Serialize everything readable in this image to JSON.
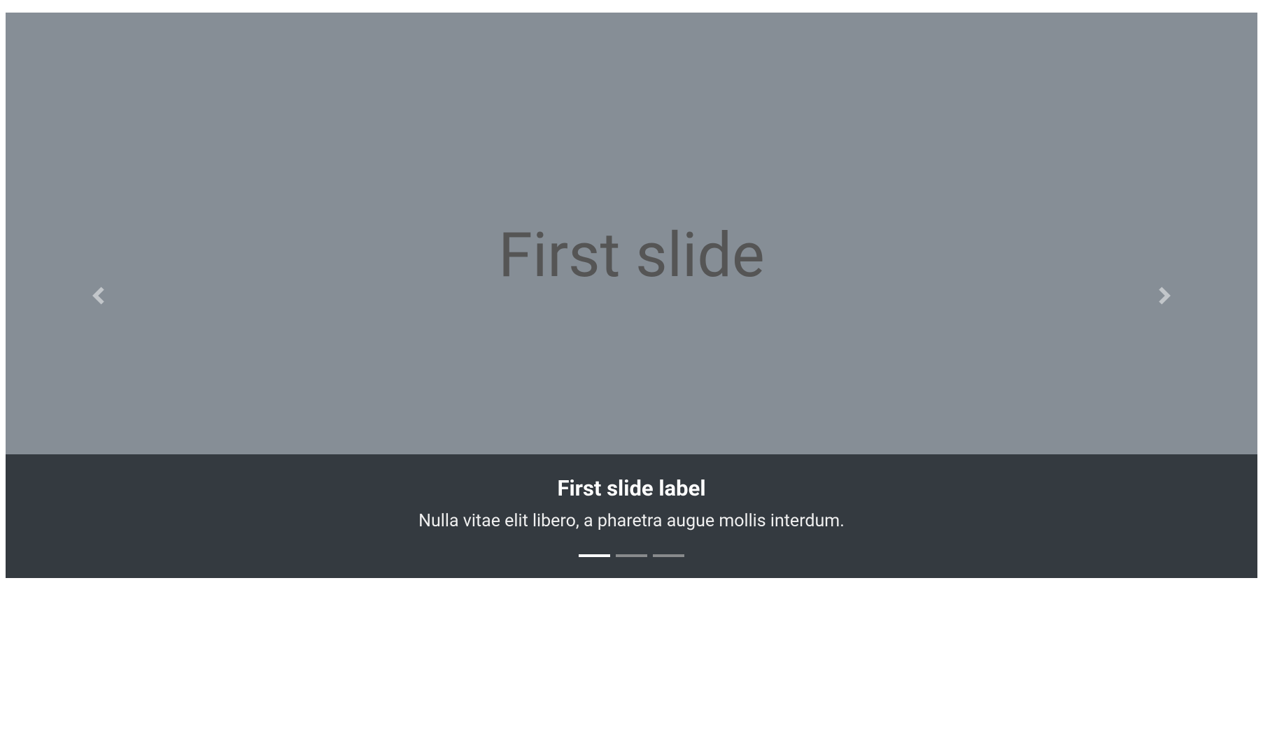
{
  "carousel": {
    "current_slide_index": 0,
    "slides": [
      {
        "placeholder_text": "First slide",
        "caption_title": "First slide label",
        "caption_body": "Nulla vitae elit libero, a pharetra augue mollis interdum."
      }
    ],
    "indicator_count": 3,
    "controls": {
      "prev_label": "Previous",
      "next_label": "Next"
    },
    "colors": {
      "slide_bg": "#868E96",
      "caption_bg": "#343A40",
      "placeholder_text": "#555",
      "caption_text": "#FFFFFF"
    }
  }
}
